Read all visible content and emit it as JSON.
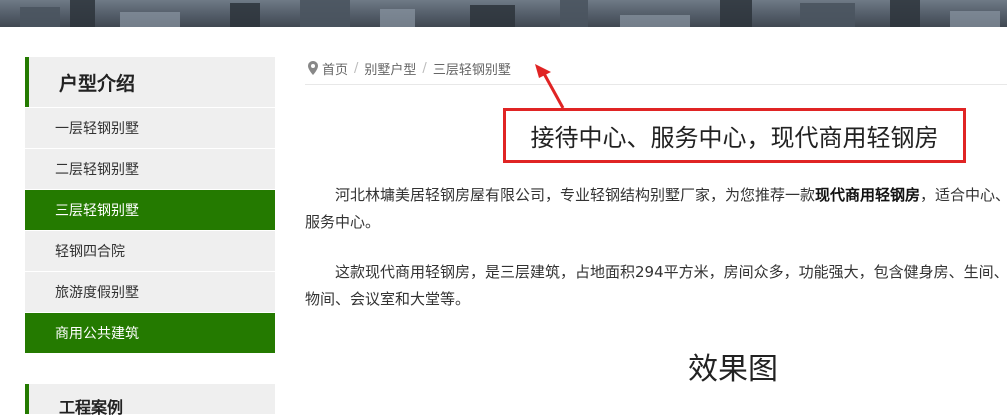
{
  "sidebar": {
    "title": "户型介绍",
    "items": [
      {
        "label": "一层轻钢别墅",
        "active": false
      },
      {
        "label": "二层轻钢别墅",
        "active": false
      },
      {
        "label": "三层轻钢别墅",
        "active": true
      },
      {
        "label": "轻钢四合院",
        "active": false
      },
      {
        "label": "旅游度假别墅",
        "active": false
      },
      {
        "label": "商用公共建筑",
        "active": true
      }
    ],
    "second_title": "工程案例"
  },
  "breadcrumb": {
    "items": [
      "首页",
      "别墅户型",
      "三层轻钢别墅"
    ],
    "separator": "/"
  },
  "article": {
    "title": "接待中心、服务中心，现代商用轻钢房",
    "para1_before": "河北林墉美居轻钢房屋有限公司，专业轻钢结构别墅厂家，为您推荐一款",
    "para1_bold": "现代商用轻钢房",
    "para1_after": "，适合中心、服务中心。",
    "para2": "这款现代商用轻钢房，是三层建筑，占地面积294平方米，房间众多，功能强大，包含健身房、生间、储物间、会议室和大堂等。",
    "section_heading": "效果图"
  },
  "colors": {
    "accent_green": "#247a00",
    "annotation_red": "#e02424"
  }
}
